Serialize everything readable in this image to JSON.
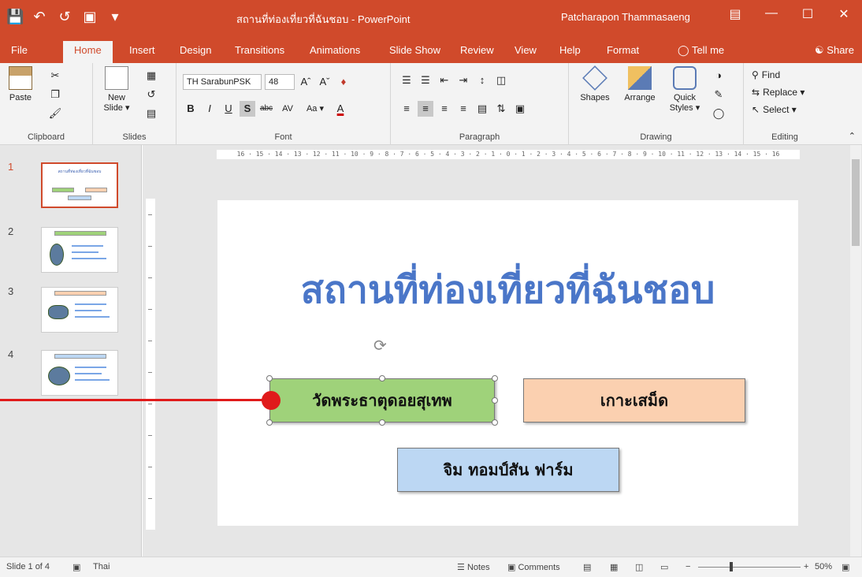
{
  "window": {
    "doc_title": "สถานที่ท่องเที่ยวที่ฉันชอบ - PowerPoint",
    "user_name": "Patcharapon Thammasaeng",
    "share_label": "Share"
  },
  "qat_icons": [
    "save-icon",
    "undo-icon",
    "redo-icon",
    "present-icon",
    "customize-icon"
  ],
  "tabs": [
    "File",
    "Home",
    "Insert",
    "Design",
    "Transitions",
    "Animations",
    "Slide Show",
    "Review",
    "View",
    "Help",
    "Format",
    "Tell me"
  ],
  "ribbon": {
    "clipboard": {
      "paste": "Paste",
      "label": "Clipboard"
    },
    "slides": {
      "new_slide": "New",
      "new_slide2": "Slide ▾",
      "label": "Slides"
    },
    "font": {
      "name": "TH SarabunPSK",
      "size": "48",
      "label": "Font",
      "aa": "Aa ▾",
      "char_spacing": "AV"
    },
    "paragraph": {
      "label": "Paragraph"
    },
    "drawing": {
      "shapes": "Shapes",
      "arrange": "Arrange",
      "quick": "Quick",
      "styles": "Styles ▾",
      "label": "Drawing"
    },
    "editing": {
      "find": "Find",
      "replace": "Replace ▾",
      "select": "Select ▾",
      "label": "Editing"
    }
  },
  "ruler": {
    "horizontal": "16 · 15 · 14 · 13 · 12 · 11 · 10 · 9 · 8 · 7 · 6 · 5 · 4 · 3 · 2 · 1 · 0 · 1 · 2 · 3 · 4 · 5 · 6 · 7 · 8 · 9 · 10 · 11 · 12 · 13 · 14 · 15 · 16"
  },
  "thumbnails": [
    {
      "num": "1",
      "title": "สถานที่ท่องเที่ยวที่ฉันชอบ"
    },
    {
      "num": "2",
      "title": "วัดพระธาตุดอยสุเทพ"
    },
    {
      "num": "3",
      "title": "เกาะเสม็ด"
    },
    {
      "num": "4",
      "title": "จิม ทอมป์สัน ฟาร์ม"
    }
  ],
  "slide": {
    "title": "สถานที่ท่องเที่ยวที่ฉันชอบ",
    "box1": "วัดพระธาตุดอยสุเทพ",
    "box2": "เกาะเสม็ด",
    "box3": "จิม ทอมป์สัน ฟาร์ม"
  },
  "colors": {
    "accent": "#d04a2b",
    "title_text": "#4a76c8",
    "box_green": "#9fd27a",
    "box_orange": "#fbd0b0",
    "box_blue": "#bcd7f3",
    "callout": "#e01b1b"
  },
  "status": {
    "slide_of": "Slide 1 of 4",
    "language": "Thai",
    "notes": "Notes",
    "comments": "Comments",
    "zoom": "50%"
  }
}
